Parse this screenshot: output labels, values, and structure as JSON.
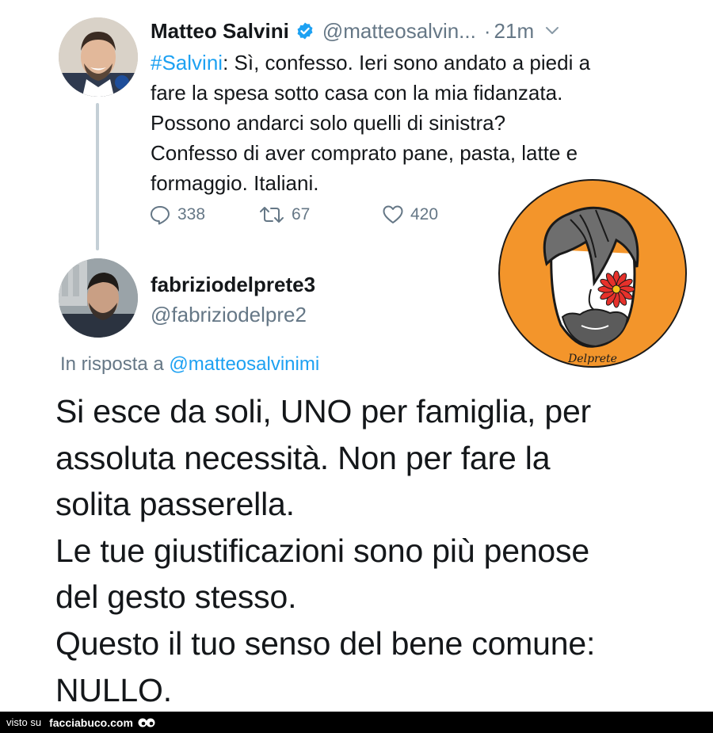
{
  "tweet": {
    "author_name": "Matteo Salvini",
    "author_handle": "@matteosalvin...",
    "separator": "·",
    "time": "21m",
    "hashtag": "#Salvini",
    "text_after_hashtag": ": Sì, confesso. Ieri sono andato a piedi a fare la spesa sotto casa con la mia fidanzata. Possono andarci solo quelli di sinistra? Confesso di aver comprato pane, pasta, latte e formaggio. Italiani.",
    "replies": "338",
    "retweets": "67",
    "likes": "420"
  },
  "reply": {
    "author_name": "fabriziodelprete3",
    "author_handle": "@fabriziodelpre2",
    "in_reply_prefix": "In risposta a ",
    "in_reply_handle": "@matteosalvinimi",
    "lines": [
      "Si esce da soli, UNO per famiglia, per",
      "assoluta necessità. Non per fare la",
      "solita passerella.",
      "Le tue giustificazioni sono più penose",
      "del gesto stesso.",
      "Questo il tuo senso del bene comune:",
      "NULLO."
    ]
  },
  "logo": {
    "signature": "Delprete"
  },
  "watermark": {
    "prefix": "visto su",
    "site": "facciabuco.com"
  },
  "colors": {
    "link": "#1da1f2",
    "secondary_text": "#657786",
    "logo_orange": "#f3952b"
  },
  "icons": {
    "verified": "verified-badge-icon",
    "chevron": "chevron-down-icon",
    "reply": "reply-icon",
    "retweet": "retweet-icon",
    "like": "heart-icon"
  }
}
